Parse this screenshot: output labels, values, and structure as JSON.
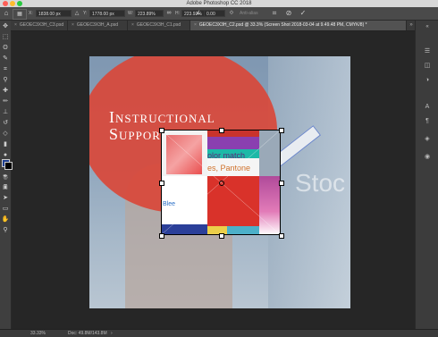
{
  "app": {
    "title": "Adobe Photoshop CC 2018"
  },
  "options_bar": {
    "x_label": "X:",
    "x_value": "1838.00 px",
    "y_label": "Y:",
    "y_value": "1778.00 px",
    "w_label": "W:",
    "w_value": "223.89%",
    "h_label": "H:",
    "h_value": "223.92%",
    "angle_value": "0.00",
    "antialias_label": "Anti-alias",
    "cancel_icon": "cancel-icon",
    "commit_icon": "check-icon"
  },
  "tabs": [
    {
      "label": "GEOEC3X3H_C3.psd"
    },
    {
      "label": "GEOEC3X3H_A.psd"
    },
    {
      "label": "GEOEC3X3H_C1.psd"
    },
    {
      "label": "GEOEC3X3H_C2.psd @ 33.3% (Screen Shot 2018-03-04 at 9.49.48 PM, CMYK/8) *"
    }
  ],
  "canvas": {
    "headline_line1": "Instructional",
    "headline_line2": "Support",
    "thumb_text_1": "olor match",
    "thumb_text_2": "es, Pantone",
    "thumb_text_3": "Blee",
    "watermark": "Stoc"
  },
  "colors": {
    "accent_red": "#d9483a",
    "foreground_swatch": "#1f3f8f",
    "background_swatch": "#000000"
  },
  "status_bar": {
    "zoom": "33.33%",
    "doc_info": "Doc: 49.8M/143.8M"
  }
}
